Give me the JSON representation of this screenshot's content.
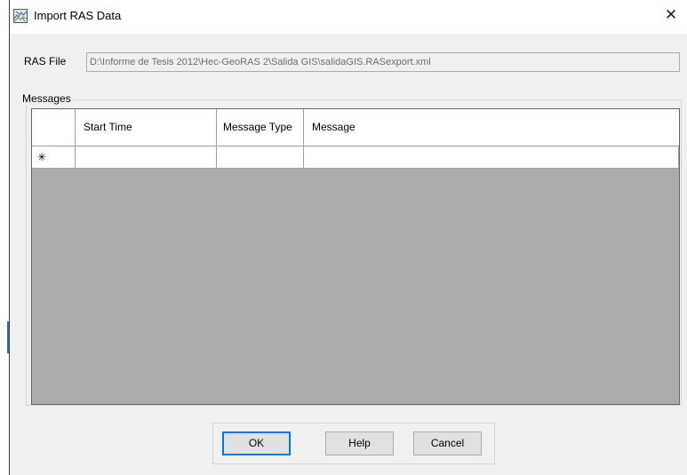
{
  "window": {
    "title": "Import RAS Data",
    "close_glyph": "✕",
    "icon": "ras-app-icon"
  },
  "ras_file": {
    "label": "RAS File",
    "value": "D:\\Informe de Tesis 2012\\Hec-GeoRAS 2\\Salida GIS\\salidaGIS.RASexport.xml"
  },
  "messages": {
    "group_label": "Messages",
    "columns": [
      "Start Time",
      "Message Type",
      "Message"
    ],
    "new_row_marker": "✳",
    "rows": []
  },
  "buttons": {
    "ok": "OK",
    "help": "Help",
    "cancel": "Cancel"
  },
  "colors": {
    "grid_background": "#ababab",
    "default_button_border": "#0078d7"
  }
}
